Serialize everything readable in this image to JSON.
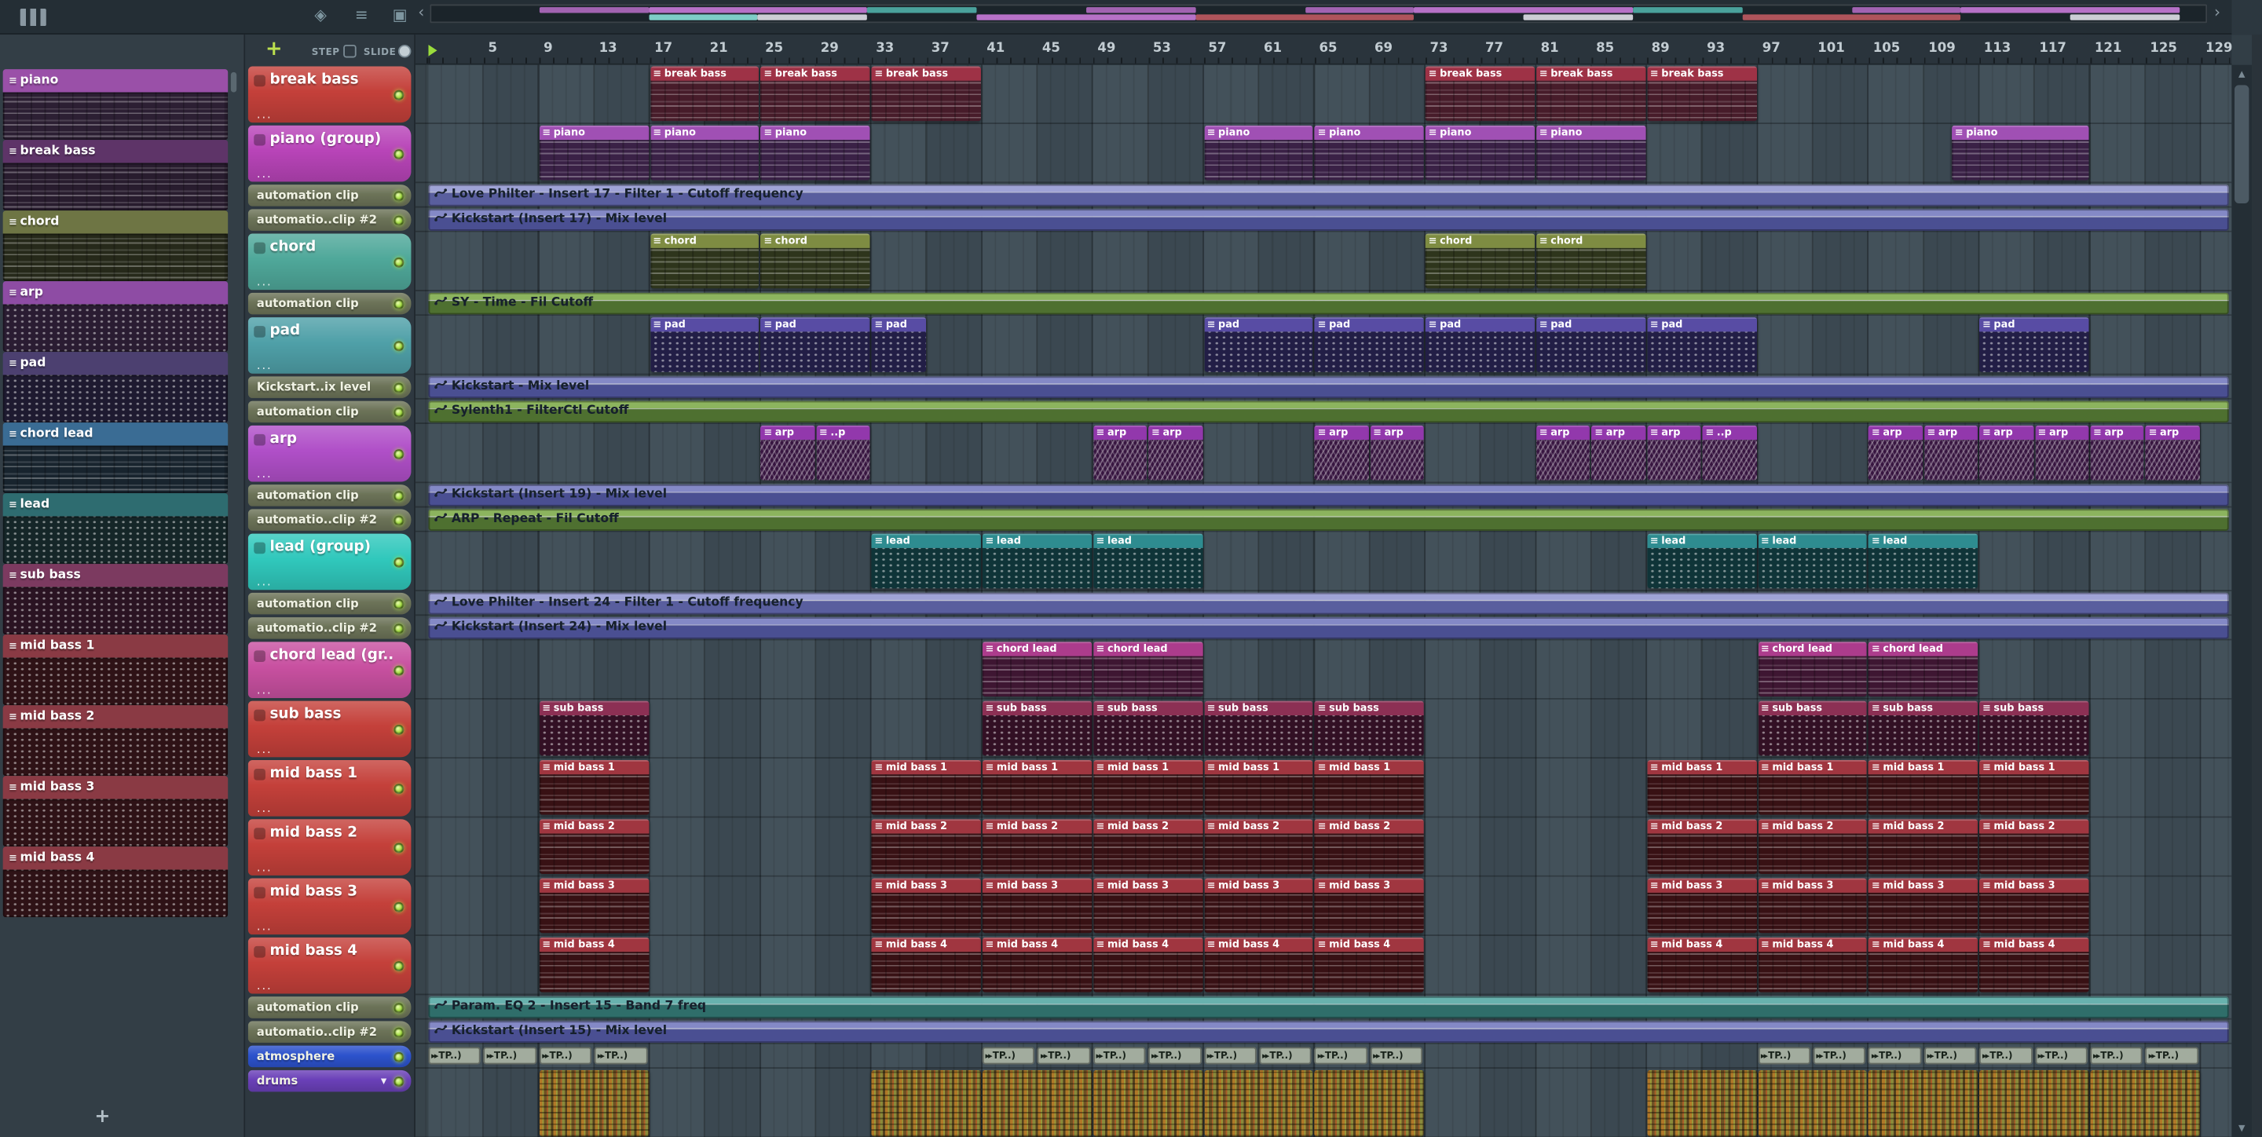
{
  "header": {
    "add_label": "+",
    "step_label": "STEP",
    "slide_label": "SLIDE"
  },
  "ruler": {
    "ticks": [
      5,
      9,
      13,
      17,
      21,
      25,
      29,
      33,
      37,
      41,
      45,
      49,
      53,
      57,
      61,
      65,
      69,
      73,
      77,
      81,
      85,
      89,
      93,
      97,
      101,
      105,
      109,
      113,
      117,
      121,
      125,
      129
    ]
  },
  "minimap": {
    "segments": [
      [
        9,
        8,
        "#b06ac0",
        0
      ],
      [
        17,
        16,
        "#c87ad8",
        0
      ],
      [
        17,
        8,
        "#8ae0d8",
        1
      ],
      [
        25,
        8,
        "#e0e0e8",
        1
      ],
      [
        33,
        8,
        "#50b0a8",
        0
      ],
      [
        41,
        16,
        "#c87ad8",
        1
      ],
      [
        49,
        8,
        "#b06ac0",
        0
      ],
      [
        57,
        16,
        "#c05a60",
        1
      ],
      [
        65,
        8,
        "#b06ac0",
        0
      ],
      [
        73,
        16,
        "#c87ad8",
        0
      ],
      [
        81,
        8,
        "#e0e0e8",
        1
      ],
      [
        89,
        8,
        "#50b0a8",
        0
      ],
      [
        97,
        16,
        "#c05a60",
        1
      ],
      [
        105,
        8,
        "#b06ac0",
        0
      ],
      [
        113,
        16,
        "#c87ad8",
        0
      ],
      [
        121,
        8,
        "#e0e0e8",
        1
      ]
    ]
  },
  "pattern_sidebar": {
    "add_label": "+",
    "items": [
      {
        "name": "piano",
        "color": "#9a50a8",
        "bg": "#2c1f33",
        "pat": "lines"
      },
      {
        "name": "break bass",
        "color": "#5e3468",
        "bg": "#281c2e",
        "pat": "lines"
      },
      {
        "name": "chord",
        "color": "#6e7544",
        "bg": "#26291a",
        "pat": "lines"
      },
      {
        "name": "arp",
        "color": "#8e4ca4",
        "bg": "#2a1c32",
        "pat": "dots"
      },
      {
        "name": "pad",
        "color": "#4c4070",
        "bg": "#1e1a30",
        "pat": "dots"
      },
      {
        "name": "chord lead",
        "color": "#3a6c94",
        "bg": "#18242e",
        "pat": "lines"
      },
      {
        "name": "lead",
        "color": "#2e6c70",
        "bg": "#152628",
        "pat": "dots"
      },
      {
        "name": "sub bass",
        "color": "#7c3a60",
        "bg": "#2a1322",
        "pat": "dots"
      },
      {
        "name": "mid bass 1",
        "color": "#8a3a44",
        "bg": "#2e1216",
        "pat": "dots"
      },
      {
        "name": "mid bass 2",
        "color": "#8a3a44",
        "bg": "#2e1216",
        "pat": "dots"
      },
      {
        "name": "mid bass 3",
        "color": "#8a3a44",
        "bg": "#2e1216",
        "pat": "dots"
      },
      {
        "name": "mid bass 4",
        "color": "#8a3a44",
        "bg": "#2e1216",
        "pat": "dots"
      }
    ]
  },
  "tracks": [
    {
      "name": "break bass",
      "kind": "track",
      "color": "#c4403a",
      "clip_label": "break bass",
      "style": {
        "hdr": "#9e3246",
        "body": "#471c2a",
        "pat": "lines"
      },
      "clips": [
        [
          17,
          8
        ],
        [
          25,
          8
        ],
        [
          33,
          8
        ],
        [
          73,
          8
        ],
        [
          81,
          8
        ],
        [
          89,
          8
        ]
      ]
    },
    {
      "name": "piano (group)",
      "kind": "track",
      "color": "#b844b8",
      "clip_label": "piano",
      "style": {
        "hdr": "#a050b4",
        "body": "#3a2146",
        "pat": "lines"
      },
      "clips": [
        [
          9,
          8
        ],
        [
          17,
          8
        ],
        [
          25,
          8
        ],
        [
          57,
          8
        ],
        [
          65,
          8
        ],
        [
          73,
          8
        ],
        [
          81,
          8
        ],
        [
          111,
          10
        ]
      ]
    },
    {
      "name": "automation clip",
      "kind": "auto",
      "color": "#6c7358",
      "auto_label": "Love Philter - Insert 17 - Filter 1 - Cutoff frequency",
      "light": "#9fa3d6",
      "dark": "#595e9e"
    },
    {
      "name": "automatio..clip #2",
      "kind": "auto",
      "color": "#6c7358",
      "auto_label": "Kickstart (Insert 17) - Mix level",
      "light": "#8489c6",
      "dark": "#4a4f92"
    },
    {
      "name": "chord",
      "kind": "track",
      "color": "#4fa89a",
      "clip_label": "chord",
      "style": {
        "hdr": "#7e8c42",
        "body": "#2e351c",
        "pat": "lines"
      },
      "clips": [
        [
          17,
          8
        ],
        [
          25,
          8
        ],
        [
          73,
          8
        ],
        [
          81,
          8
        ]
      ]
    },
    {
      "name": "automation clip",
      "kind": "auto",
      "color": "#6c7358",
      "auto_label": "SY - Time - Fil Cutoff",
      "light": "#8cb45e",
      "dark": "#4e7030"
    },
    {
      "name": "pad",
      "kind": "track",
      "color": "#4fa0a8",
      "clip_label": "pad",
      "style": {
        "hdr": "#584ca4",
        "body": "#221e46",
        "pat": "dots"
      },
      "clips": [
        [
          17,
          8
        ],
        [
          25,
          8
        ],
        [
          33,
          4
        ],
        [
          57,
          8
        ],
        [
          65,
          8
        ],
        [
          73,
          8
        ],
        [
          81,
          8
        ],
        [
          89,
          8
        ],
        [
          113,
          8
        ]
      ]
    },
    {
      "name": "Kickstart..ix level",
      "kind": "auto",
      "color": "#6c7358",
      "auto_label": "Kickstart - Mix level",
      "light": "#8489c6",
      "dark": "#4a4f92"
    },
    {
      "name": "automation clip",
      "kind": "auto",
      "color": "#6c7358",
      "auto_label": "Sylenth1 - FilterCtl Cutoff",
      "light": "#8cb45e",
      "dark": "#4e7030"
    },
    {
      "name": "arp",
      "kind": "track",
      "color": "#b04fc8",
      "clip_label": "arp",
      "style": {
        "hdr": "#9238ac",
        "body": "#371540",
        "pat": "zig"
      },
      "clips": [
        [
          25,
          4
        ],
        [
          29,
          4,
          "..p"
        ],
        [
          49,
          4
        ],
        [
          53,
          4
        ],
        [
          65,
          4
        ],
        [
          69,
          4
        ],
        [
          81,
          4
        ],
        [
          85,
          4
        ],
        [
          89,
          4
        ],
        [
          93,
          4,
          "..p"
        ],
        [
          105,
          4
        ],
        [
          109,
          4
        ],
        [
          113,
          4
        ],
        [
          117,
          4
        ],
        [
          121,
          4
        ],
        [
          125,
          4
        ]
      ]
    },
    {
      "name": "automation clip",
      "kind": "auto",
      "color": "#6c7358",
      "auto_label": "Kickstart (Insert 19) - Mix level",
      "light": "#8489c6",
      "dark": "#4a4f92"
    },
    {
      "name": "automatio..clip #2",
      "kind": "auto",
      "color": "#6c7358",
      "auto_label": "ARP - Repeat - Fil Cutoff",
      "light": "#8cb45e",
      "dark": "#4e7030"
    },
    {
      "name": "lead (group)",
      "kind": "track",
      "color": "#30c8bc",
      "clip_label": "lead",
      "style": {
        "hdr": "#2e8c90",
        "body": "#0f3438",
        "pat": "dots"
      },
      "clips": [
        [
          33,
          8
        ],
        [
          41,
          8
        ],
        [
          49,
          8
        ],
        [
          89,
          8
        ],
        [
          97,
          8
        ],
        [
          105,
          8
        ]
      ]
    },
    {
      "name": "automation clip",
      "kind": "auto",
      "color": "#6c7358",
      "auto_label": "Love Philter - Insert 24 - Filter 1 - Cutoff frequency",
      "light": "#9fa3d6",
      "dark": "#595e9e"
    },
    {
      "name": "automatio..clip #2",
      "kind": "auto",
      "color": "#6c7358",
      "auto_label": "Kickstart (Insert 24) - Mix level",
      "light": "#8489c6",
      "dark": "#4a4f92"
    },
    {
      "name": "chord lead (gr..",
      "kind": "track",
      "color": "#c850a0",
      "clip_label": "chord lead",
      "style": {
        "hdr": "#ac3c8c",
        "body": "#3e1632",
        "pat": "lines"
      },
      "clips": [
        [
          41,
          8
        ],
        [
          49,
          8
        ],
        [
          97,
          8
        ],
        [
          105,
          8
        ]
      ]
    },
    {
      "name": "sub bass",
      "kind": "track",
      "color": "#c4403a",
      "clip_label": "sub bass",
      "style": {
        "hdr": "#8c3054",
        "body": "#321024",
        "pat": "dots"
      },
      "clips": [
        [
          9,
          8
        ],
        [
          41,
          8
        ],
        [
          49,
          8
        ],
        [
          57,
          8
        ],
        [
          65,
          8
        ],
        [
          97,
          8
        ],
        [
          105,
          8
        ],
        [
          113,
          8
        ]
      ]
    },
    {
      "name": "mid bass 1",
      "kind": "track",
      "color": "#c4403a",
      "clip_label": "mid bass 1",
      "style": {
        "hdr": "#a03640",
        "body": "#381114",
        "pat": "lines"
      },
      "clips": [
        [
          9,
          8
        ],
        [
          33,
          8
        ],
        [
          41,
          8
        ],
        [
          49,
          8
        ],
        [
          57,
          8
        ],
        [
          65,
          8
        ],
        [
          89,
          8
        ],
        [
          97,
          8
        ],
        [
          105,
          8
        ],
        [
          113,
          8
        ]
      ]
    },
    {
      "name": "mid bass 2",
      "kind": "track",
      "color": "#c4403a",
      "clip_label": "mid bass 2",
      "style": {
        "hdr": "#a03640",
        "body": "#381114",
        "pat": "lines"
      },
      "clips": [
        [
          9,
          8
        ],
        [
          33,
          8
        ],
        [
          41,
          8
        ],
        [
          49,
          8
        ],
        [
          57,
          8
        ],
        [
          65,
          8
        ],
        [
          89,
          8
        ],
        [
          97,
          8
        ],
        [
          105,
          8
        ],
        [
          113,
          8
        ]
      ]
    },
    {
      "name": "mid bass 3",
      "kind": "track",
      "color": "#c4403a",
      "clip_label": "mid bass 3",
      "style": {
        "hdr": "#a03640",
        "body": "#381114",
        "pat": "lines"
      },
      "clips": [
        [
          9,
          8
        ],
        [
          33,
          8
        ],
        [
          41,
          8
        ],
        [
          49,
          8
        ],
        [
          57,
          8
        ],
        [
          65,
          8
        ],
        [
          89,
          8
        ],
        [
          97,
          8
        ],
        [
          105,
          8
        ],
        [
          113,
          8
        ]
      ]
    },
    {
      "name": "mid bass 4",
      "kind": "track",
      "color": "#c4403a",
      "clip_label": "mid bass 4",
      "style": {
        "hdr": "#a03640",
        "body": "#381114",
        "pat": "lines"
      },
      "clips": [
        [
          9,
          8
        ],
        [
          33,
          8
        ],
        [
          41,
          8
        ],
        [
          49,
          8
        ],
        [
          57,
          8
        ],
        [
          65,
          8
        ],
        [
          89,
          8
        ],
        [
          97,
          8
        ],
        [
          105,
          8
        ],
        [
          113,
          8
        ]
      ]
    },
    {
      "name": "automation clip",
      "kind": "auto",
      "color": "#6c7358",
      "auto_label": "Param. EQ 2 - Insert 15 - Band 7 freq",
      "light": "#68b2ae",
      "dark": "#2f6e6a"
    },
    {
      "name": "automatio..clip #2",
      "kind": "auto",
      "color": "#6c7358",
      "auto_label": "Kickstart (Insert 15) - Mix level",
      "light": "#8489c6",
      "dark": "#4a4f92"
    },
    {
      "name": "atmosphere",
      "kind": "thin",
      "color": "#2c52cc",
      "clip_label": "TP..)",
      "style": {
        "hdr": "#a2ac9e",
        "body": "#a2ac9e",
        "pat": "chip"
      },
      "clips": [
        [
          1,
          4
        ],
        [
          5,
          4
        ],
        [
          9,
          4
        ],
        [
          13,
          4
        ],
        [
          41,
          4
        ],
        [
          45,
          4
        ],
        [
          49,
          4
        ],
        [
          53,
          4
        ],
        [
          57,
          4
        ],
        [
          61,
          4
        ],
        [
          65,
          4
        ],
        [
          69,
          4
        ],
        [
          97,
          4
        ],
        [
          101,
          4
        ],
        [
          105,
          4
        ],
        [
          109,
          4
        ],
        [
          113,
          4
        ],
        [
          117,
          4
        ],
        [
          121,
          4
        ],
        [
          125,
          4
        ]
      ]
    },
    {
      "name": "drums",
      "kind": "thin",
      "color": "#6a40b8",
      "chevron": true,
      "clip_label": "",
      "style": {
        "hdr": "#8a7a30",
        "body": "#2e2817",
        "pat": "drum"
      },
      "clips": [
        [
          9,
          8
        ],
        [
          33,
          8
        ],
        [
          41,
          8
        ],
        [
          49,
          8
        ],
        [
          57,
          8
        ],
        [
          65,
          8
        ],
        [
          89,
          8
        ],
        [
          97,
          8
        ],
        [
          105,
          8
        ],
        [
          113,
          8
        ],
        [
          121,
          8
        ]
      ]
    }
  ]
}
